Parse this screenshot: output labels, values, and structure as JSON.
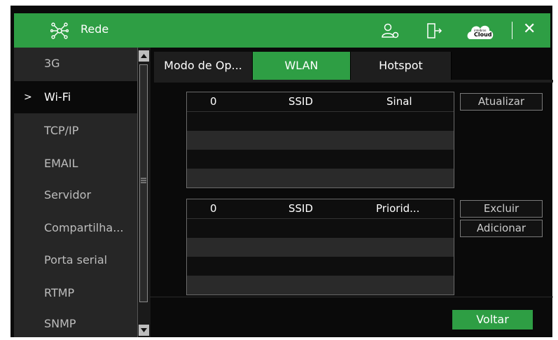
{
  "window": {
    "title": "Rede"
  },
  "sidebar": {
    "items": [
      {
        "label": "3G"
      },
      {
        "label": "Wi-Fi"
      },
      {
        "label": "TCP/IP"
      },
      {
        "label": "EMAIL"
      },
      {
        "label": "Servidor"
      },
      {
        "label": "Compartilha..."
      },
      {
        "label": "Porta serial"
      },
      {
        "label": "RTMP"
      },
      {
        "label": "SNMP"
      }
    ],
    "active_index": 1,
    "active_marker": ">"
  },
  "tabs": [
    {
      "label": "Modo de Op..."
    },
    {
      "label": "WLAN",
      "active": true
    },
    {
      "label": "Hotspot"
    }
  ],
  "scan_table": {
    "columns": [
      "0",
      "SSID",
      "Sinal"
    ],
    "rows": []
  },
  "saved_table": {
    "columns": [
      "0",
      "SSID",
      "Priorid..."
    ],
    "rows": []
  },
  "buttons": {
    "refresh": "Atualizar",
    "delete": "Excluir",
    "add": "Adicionar",
    "back": "Voltar"
  },
  "cloud_logo": {
    "brand": "intelbras",
    "text": "Cloud"
  },
  "icons": [
    "network-icon",
    "user-settings-icon",
    "logout-icon",
    "cloud-icon",
    "close-icon"
  ],
  "colors": {
    "accent": "#2e9e44",
    "background": "#0a0a0a",
    "sidebar": "#262626"
  }
}
